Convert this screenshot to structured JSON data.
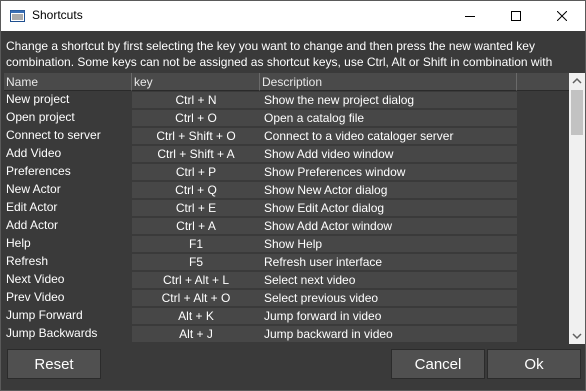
{
  "window": {
    "title": "Shortcuts"
  },
  "description": "Change a shortcut by first selecting the key you want to change and then press the new wanted key combination. Some keys can not be assigned as shortcut keys, use Ctrl, Alt or Shift in combination with keys.",
  "table": {
    "columns": [
      "Name",
      "key",
      "Description"
    ],
    "rows": [
      {
        "name": "New project",
        "key": "Ctrl + N",
        "description": "Show the new project dialog"
      },
      {
        "name": "Open project",
        "key": "Ctrl + O",
        "description": "Open a catalog file"
      },
      {
        "name": "Connect to server",
        "key": "Ctrl + Shift + O",
        "description": "Connect to a video cataloger server"
      },
      {
        "name": "Add Video",
        "key": "Ctrl + Shift + A",
        "description": "Show Add video window"
      },
      {
        "name": "Preferences",
        "key": "Ctrl + P",
        "description": "Show Preferences window"
      },
      {
        "name": "New Actor",
        "key": "Ctrl + Q",
        "description": "Show New Actor dialog"
      },
      {
        "name": "Edit Actor",
        "key": "Ctrl + E",
        "description": "Show Edit Actor dialog"
      },
      {
        "name": "Add Actor",
        "key": "Ctrl + A",
        "description": "Show Add Actor window"
      },
      {
        "name": "Help",
        "key": "F1",
        "description": "Show Help"
      },
      {
        "name": "Refresh",
        "key": "F5",
        "description": "Refresh user interface"
      },
      {
        "name": "Next Video",
        "key": "Ctrl + Alt + L",
        "description": "Select next video"
      },
      {
        "name": "Prev Video",
        "key": "Ctrl + Alt + O",
        "description": "Select previous video"
      },
      {
        "name": "Jump Forward",
        "key": "Alt + K",
        "description": "Jump forward in video"
      },
      {
        "name": "Jump Backwards",
        "key": "Alt + J",
        "description": "Jump backward in video"
      }
    ]
  },
  "buttons": {
    "reset": "Reset",
    "cancel": "Cancel",
    "ok": "Ok"
  },
  "icons": {
    "app": "list-window-icon",
    "minimize": "minimize-icon",
    "maximize": "maximize-icon",
    "close": "close-icon"
  }
}
